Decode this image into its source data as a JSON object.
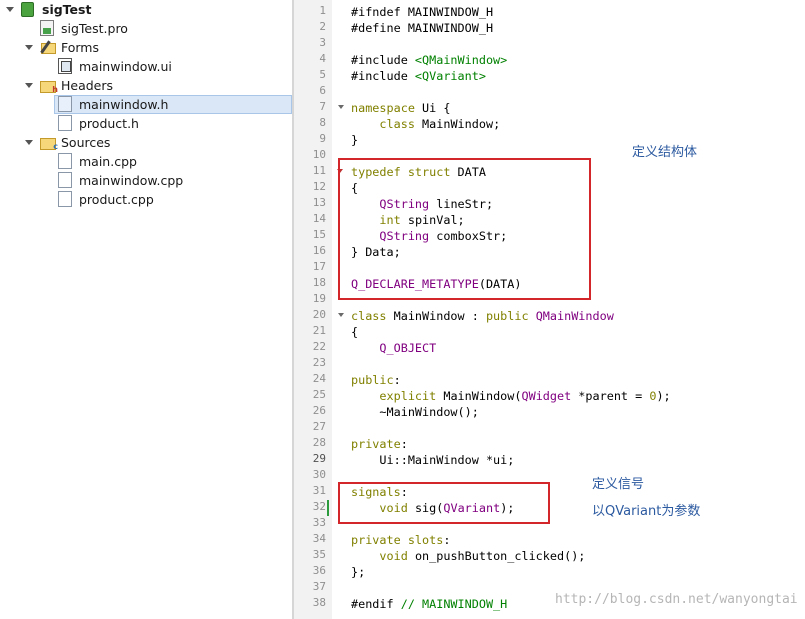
{
  "tree": {
    "project": "sigTest",
    "pro_file": "sigTest.pro",
    "forms_label": "Forms",
    "forms_items": [
      "mainwindow.ui"
    ],
    "headers_label": "Headers",
    "headers_items": [
      "mainwindow.h",
      "product.h"
    ],
    "sources_label": "Sources",
    "sources_items": [
      "main.cpp",
      "mainwindow.cpp",
      "product.cpp"
    ],
    "selected_item": "mainwindow.h"
  },
  "editor": {
    "current_line": 29,
    "lines": [
      [
        [
          "#ifndef MAINWINDOW_H",
          ""
        ]
      ],
      [
        [
          "#define MAINWINDOW_H",
          ""
        ]
      ],
      [],
      [
        [
          "#include ",
          ""
        ],
        [
          "<QMainWindow>",
          "s"
        ]
      ],
      [
        [
          "#include ",
          ""
        ],
        [
          "<QVariant>",
          "s"
        ]
      ],
      [],
      [
        [
          "namespace",
          "k"
        ],
        [
          " Ui {",
          ""
        ]
      ],
      [
        [
          "    ",
          ""
        ],
        [
          "class",
          "k"
        ],
        [
          " MainWindow;",
          ""
        ]
      ],
      [
        [
          "}",
          ""
        ]
      ],
      [],
      [
        [
          "typedef",
          "k"
        ],
        [
          " ",
          ""
        ],
        [
          "struct",
          "k"
        ],
        [
          " DATA",
          ""
        ]
      ],
      [
        [
          "{",
          ""
        ]
      ],
      [
        [
          "    ",
          ""
        ],
        [
          "QString",
          "t"
        ],
        [
          " lineStr;",
          ""
        ]
      ],
      [
        [
          "    ",
          ""
        ],
        [
          "int",
          "k"
        ],
        [
          " spinVal;",
          ""
        ]
      ],
      [
        [
          "    ",
          ""
        ],
        [
          "QString",
          "t"
        ],
        [
          " comboxStr;",
          ""
        ]
      ],
      [
        [
          "} Data;",
          ""
        ]
      ],
      [],
      [
        [
          "Q_DECLARE_METATYPE",
          "t"
        ],
        [
          "(DATA)",
          ""
        ]
      ],
      [],
      [
        [
          "class",
          "k"
        ],
        [
          " MainWindow : ",
          ""
        ],
        [
          "public",
          "k"
        ],
        [
          " ",
          ""
        ],
        [
          "QMainWindow",
          "t"
        ]
      ],
      [
        [
          "{",
          ""
        ]
      ],
      [
        [
          "    ",
          ""
        ],
        [
          "Q_OBJECT",
          "t"
        ]
      ],
      [],
      [
        [
          "public",
          "k"
        ],
        [
          ":",
          ""
        ]
      ],
      [
        [
          "    ",
          ""
        ],
        [
          "explicit",
          "k"
        ],
        [
          " MainWindow(",
          ""
        ],
        [
          "QWidget",
          "t"
        ],
        [
          " *parent = ",
          ""
        ],
        [
          "0",
          "k"
        ],
        [
          ");",
          ""
        ]
      ],
      [
        [
          "    ~MainWindow();",
          ""
        ]
      ],
      [],
      [
        [
          "private",
          "k"
        ],
        [
          ":",
          ""
        ]
      ],
      [
        [
          "    Ui::MainWindow *ui;",
          ""
        ]
      ],
      [],
      [
        [
          "signals",
          "k"
        ],
        [
          ":",
          ""
        ]
      ],
      [
        [
          "    ",
          ""
        ],
        [
          "void",
          "k"
        ],
        [
          " sig(",
          ""
        ],
        [
          "QVariant",
          "t"
        ],
        [
          ");",
          ""
        ]
      ],
      [],
      [
        [
          "private",
          "k"
        ],
        [
          " ",
          ""
        ],
        [
          "slots",
          "k"
        ],
        [
          ":",
          ""
        ]
      ],
      [
        [
          "    ",
          ""
        ],
        [
          "void",
          "k"
        ],
        [
          " on_pushButton_clicked();",
          ""
        ]
      ],
      [
        [
          "};",
          ""
        ]
      ],
      [],
      [
        [
          "#endif ",
          ""
        ],
        [
          "// MAINWINDOW_H",
          "c"
        ]
      ]
    ]
  },
  "annotations": {
    "struct_note": "定义结构体",
    "signal_note": "定义信号",
    "param_note": "以QVariant为参数"
  },
  "watermark": "http://blog.csdn.net/wanyongtai",
  "colors": {
    "keyword": "#808000",
    "type": "#800080",
    "string": "#008000",
    "highlight_box": "#d3262b",
    "annotation": "#2c5aa0"
  }
}
